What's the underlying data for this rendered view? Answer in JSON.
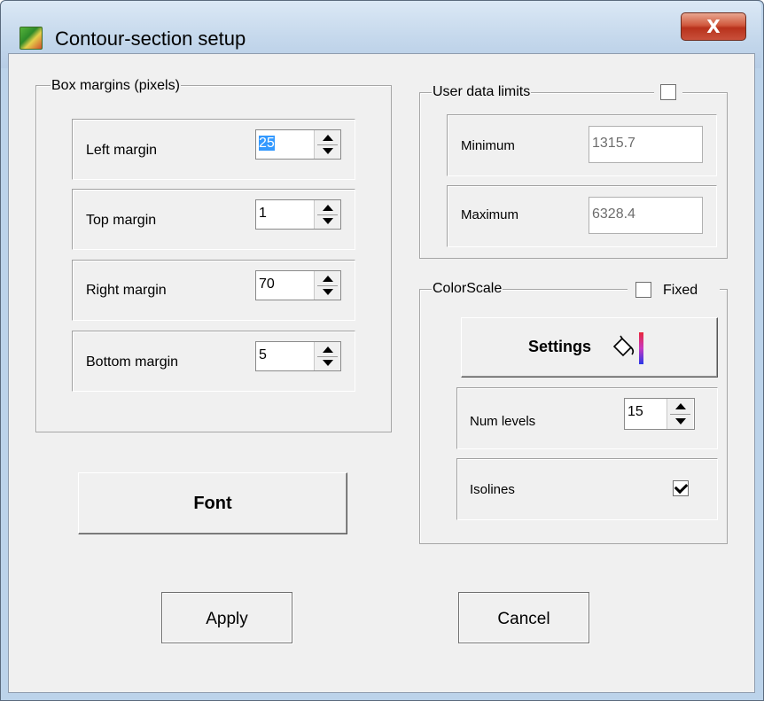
{
  "window": {
    "title": "Contour-section setup",
    "close_label": "X"
  },
  "box_margins": {
    "title": "Box margins (pixels)",
    "fields": [
      {
        "label": "Left margin",
        "value": "25"
      },
      {
        "label": "Top margin",
        "value": "1"
      },
      {
        "label": "Right margin",
        "value": "70"
      },
      {
        "label": "Bottom margin",
        "value": "5"
      }
    ]
  },
  "user_data_limits": {
    "title": "User data limits",
    "enabled": false,
    "minimum_label": "Minimum",
    "minimum_value": "1315.7",
    "maximum_label": "Maximum",
    "maximum_value": "6328.4"
  },
  "colorscale": {
    "title": "ColorScale",
    "fixed_label": "Fixed",
    "fixed_checked": false,
    "settings_label": "Settings",
    "num_levels_label": "Num levels",
    "num_levels_value": "15",
    "isolines_label": "Isolines",
    "isolines_checked": true
  },
  "buttons": {
    "font": "Font",
    "apply": "Apply",
    "cancel": "Cancel"
  }
}
